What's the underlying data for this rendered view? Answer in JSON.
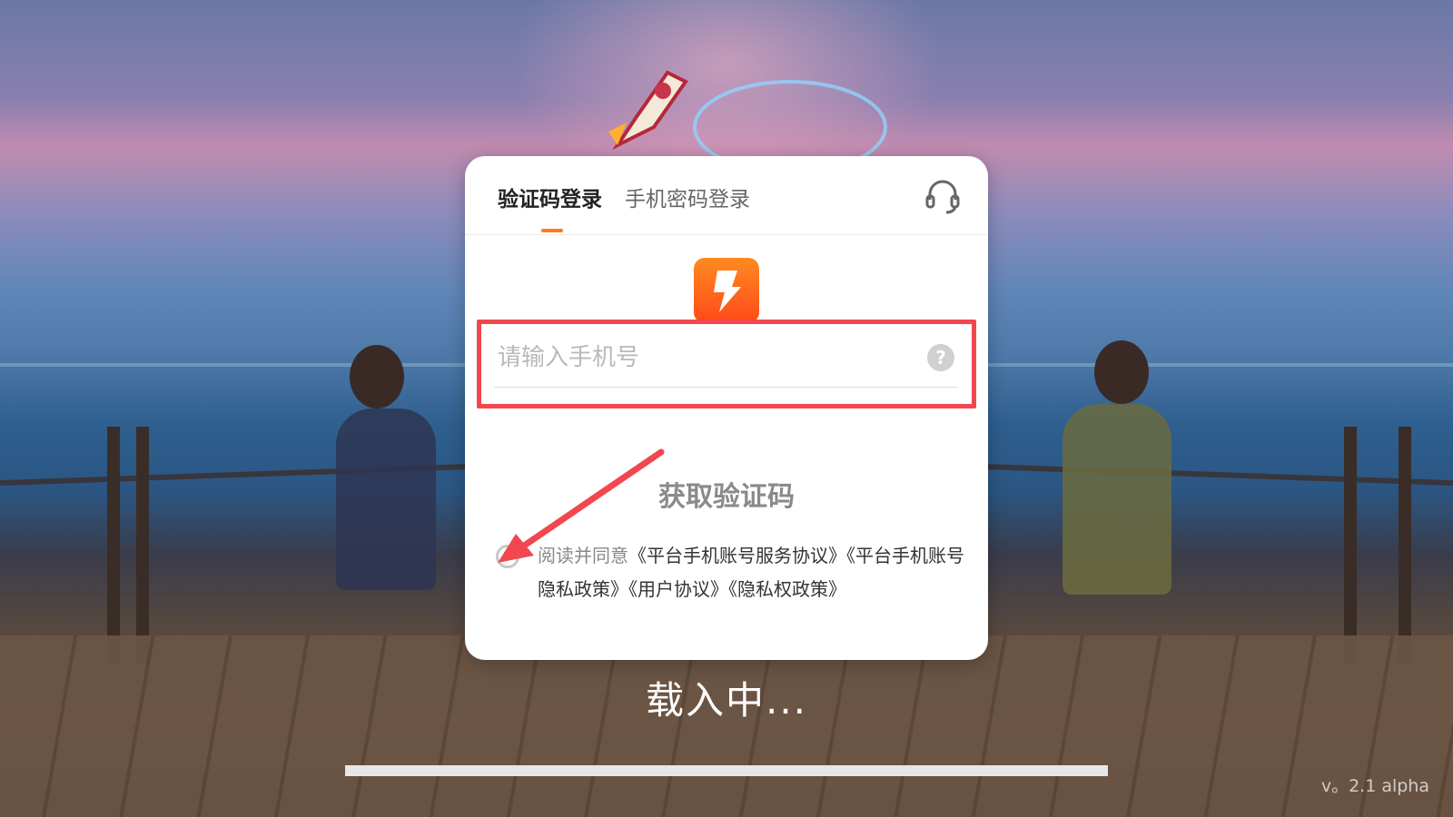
{
  "tabs": [
    {
      "label": "验证码登录",
      "active": true
    },
    {
      "label": "手机密码登录",
      "active": false
    }
  ],
  "icons": {
    "support": "headset-icon",
    "app": "app-logo-icon",
    "help": "question-icon"
  },
  "phone_input": {
    "placeholder": "请输入手机号",
    "value": ""
  },
  "get_code_label": "获取验证码",
  "agreement": {
    "lead": "阅读并同意",
    "links": [
      "《平台手机账号服务协议》",
      "《平台手机账号隐私政策》",
      "《用户协议》",
      "《隐私权政策》"
    ]
  },
  "loading_text": "载入中...",
  "version": "v。2.1 alpha",
  "colors": {
    "accent": "#ff7a1a",
    "highlight": "#f2474f"
  }
}
